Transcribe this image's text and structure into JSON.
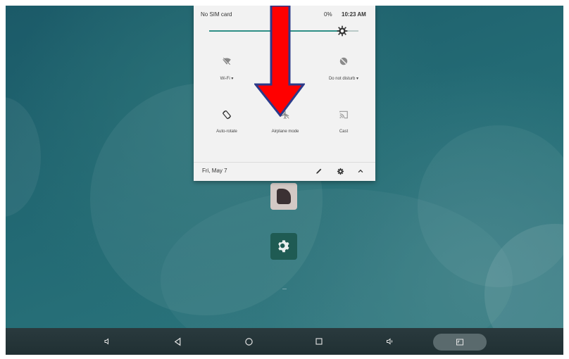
{
  "status_bar": {
    "carrier": "No SIM card",
    "battery": "0%",
    "time": "10:23 AM"
  },
  "brightness": {
    "level": 0.9
  },
  "tiles": [
    {
      "label": "Wi-Fi ▾",
      "icon": "wifi-off-icon"
    },
    {
      "label": "",
      "icon": "bluetooth-icon"
    },
    {
      "label": "Do not disturb ▾",
      "icon": "do-not-disturb-icon"
    },
    {
      "label": "Auto-rotate",
      "icon": "auto-rotate-icon"
    },
    {
      "label": "Airplane mode",
      "icon": "airplane-icon"
    },
    {
      "label": "Cast",
      "icon": "cast-icon"
    }
  ],
  "footer": {
    "date": "Fri, May 7"
  },
  "annotation": {
    "color": "#ff0000",
    "outline": "#2b3a8a"
  },
  "colors": {
    "accent": "#2f8f86",
    "panel": "#f2f2f2"
  }
}
